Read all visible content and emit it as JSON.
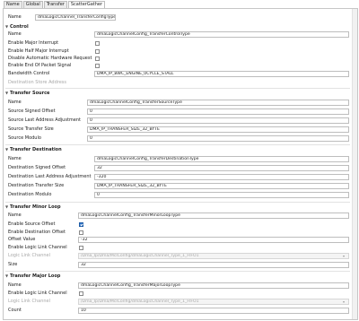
{
  "tabs": [
    "Name",
    "Global",
    "Transfer",
    "ScatterGather"
  ],
  "name_row": {
    "label": "Name",
    "value": "dmaLogicChannel_TransferConfigType"
  },
  "control": {
    "title": "Control",
    "name_label": "Name",
    "name_value": "dmaLogicChannelConfig_TransferControlType",
    "enable_major_interrupt": "Enable Major Interrupt",
    "enable_half_major_interrupt": "Enable Half Major Interrupt",
    "disable_auto_hw_request": "Disable Automatic Hardware Request",
    "enable_end_of_packet": "Enable End Of Packet Signal",
    "bandwidth_label": "Bandwidth Control",
    "bandwidth_value": "DMA_IP_BWC_ENGINE_0CYCLE_STALL",
    "destination_label": "Destination Store Address"
  },
  "source": {
    "title": "Transfer Source",
    "name_label": "Name",
    "name_value": "dmaLogicChannelConfig_TransferSourceType",
    "signed_offset_label": "Source Signed Offset",
    "signed_offset_value": "0",
    "last_addr_label": "Source Last Address Adjustment",
    "last_addr_value": "0",
    "size_label": "Source Transfer Size",
    "size_value": "DMA_IP_TRANSFER_SIZE_32_BYTE",
    "modulo_label": "Source Modulo",
    "modulo_value": "0"
  },
  "destination": {
    "title": "Transfer Destination",
    "name_label": "Name",
    "name_value": "dmaLogicChannelConfig_TransferDestinationType",
    "signed_offset_label": "Destination Signed Offset",
    "signed_offset_value": "32",
    "last_addr_label": "Destination Last Address Adjustment",
    "last_addr_value": "-320",
    "size_label": "Destination Transfer Size",
    "size_value": "DMA_IP_TRANSFER_SIZE_32_BYTE",
    "modulo_label": "Destination Modulo",
    "modulo_value": "0"
  },
  "minor": {
    "title": "Transfer Minor Loop",
    "name_label": "Name",
    "name_value": "dmaLogicChannelConfig_TransferMinorLoopType",
    "enable_source_offset": "Enable Source Offset",
    "enable_destination_offset": "Enable Destination Offset",
    "offset_label": "Offset Value",
    "offset_value": "-32",
    "enable_link": "Enable Logic Link Channel",
    "link_label": "Logic Link Channel",
    "link_value": "/Dma_Ip/Dma/MclConfig/dmaLogicChannel_Type_1_FIFO1",
    "size_label": "Size",
    "size_value": "32"
  },
  "major": {
    "title": "Transfer Major Loop",
    "name_label": "Name",
    "name_value": "dmaLogicChannelConfig_TransferMajorLoopType",
    "enable_link": "Enable Logic Link Channel",
    "link_label": "Logic Link Channel",
    "link_value": "/Dma_Ip/Dma/MclConfig/dmaLogicChannel_Type_1_FIFO1",
    "count_label": "Count",
    "count_value": "10"
  }
}
